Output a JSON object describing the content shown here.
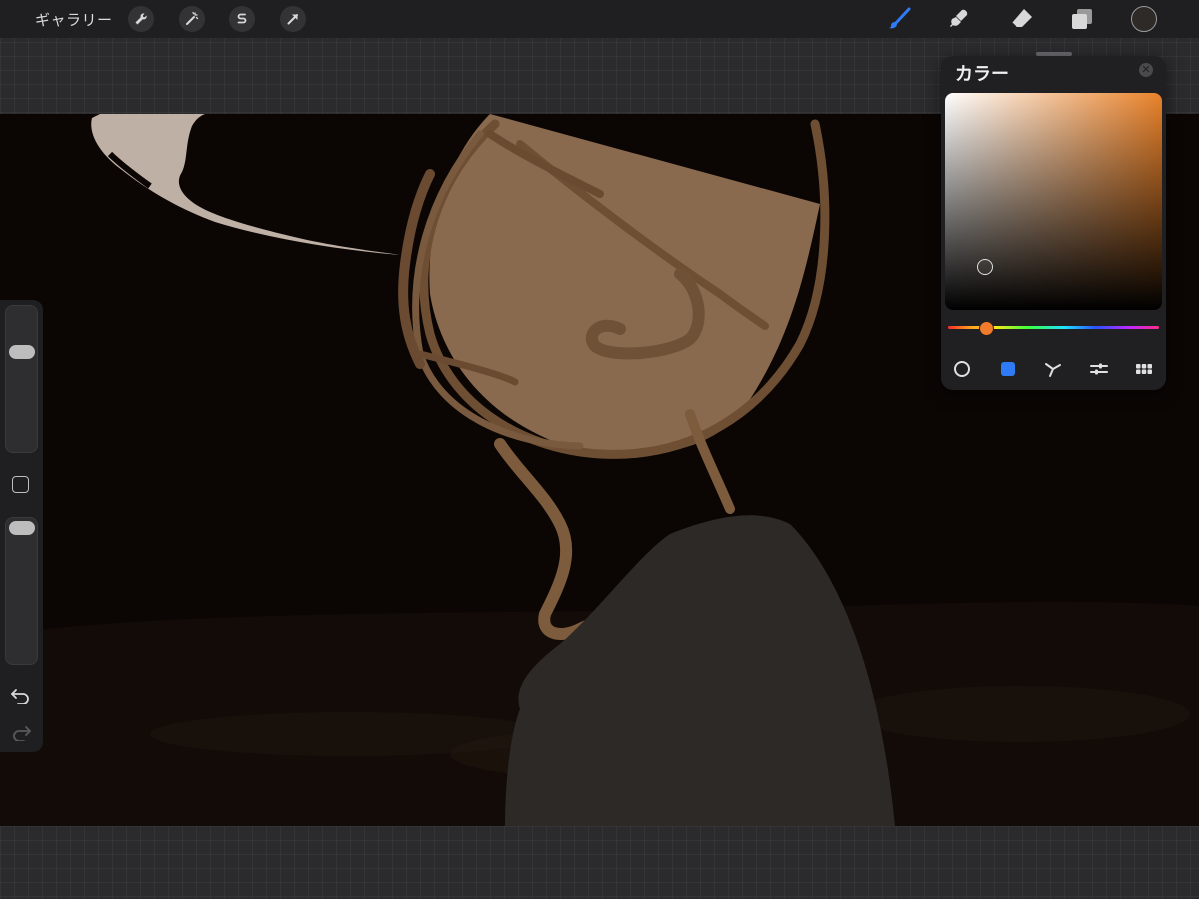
{
  "toolbar": {
    "gallery_label": "ギャラリー",
    "left_icons": [
      "wrench-icon",
      "magic-wand-icon",
      "selection-s-icon",
      "transform-arrow-icon"
    ],
    "right_icons": [
      "brush-icon",
      "smudge-icon",
      "eraser-icon",
      "layers-icon"
    ],
    "current_color": "#2d2a27",
    "active_tool_color": "#2f7bf5"
  },
  "color_panel": {
    "title": "カラー",
    "close_symbol": "✕",
    "hue_color": "#e9822a",
    "modes": [
      "disc-mode-icon",
      "classic-mode-icon",
      "harmony-mode-icon",
      "value-mode-icon",
      "palettes-mode-icon"
    ],
    "active_mode": "classic-mode-icon"
  },
  "sidebar": {
    "brush_size_level": 0.18,
    "opacity_level": 0.05,
    "undo_icon": "undo-icon",
    "redo_icon": "redo-icon"
  }
}
